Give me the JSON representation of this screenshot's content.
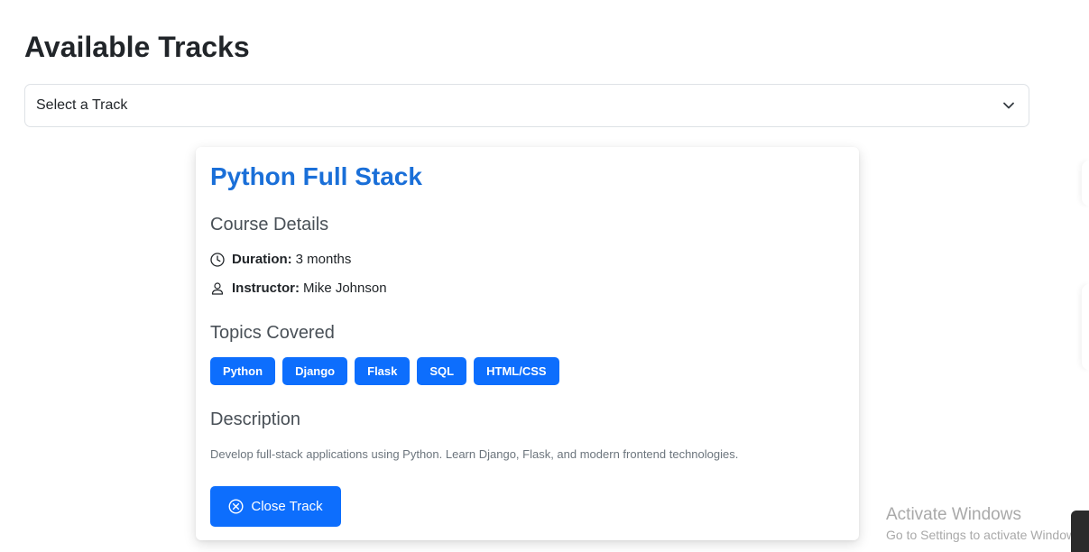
{
  "page": {
    "title": "Available Tracks"
  },
  "track_select": {
    "selected": "Select a Track",
    "chevron_icon": "chevron-down-icon"
  },
  "track": {
    "name": "Python Full Stack",
    "details_heading": "Course Details",
    "duration_label": "Duration:",
    "duration_value": "3 months",
    "duration_icon": "clock-icon",
    "instructor_label": "Instructor:",
    "instructor_value": "Mike Johnson",
    "instructor_icon": "person-icon",
    "topics_heading": "Topics Covered",
    "topics": [
      "Python",
      "Django",
      "Flask",
      "SQL",
      "HTML/CSS"
    ],
    "description_heading": "Description",
    "description": "Develop full-stack applications using Python. Learn Django, Flask, and modern frontend technologies.",
    "close_label": "Close Track",
    "close_icon": "close-circle-icon"
  },
  "watermark": {
    "title": "Activate Windows",
    "subtitle": "Go to Settings to activate Windows."
  },
  "colors": {
    "primary": "#0d6efd",
    "track_title": "#1a6fd8",
    "heading": "#495057",
    "muted": "#6c757d"
  }
}
